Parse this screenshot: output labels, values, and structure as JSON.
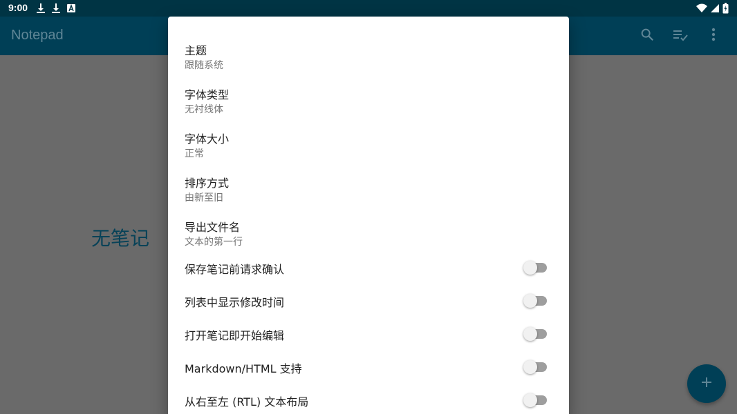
{
  "status_bar": {
    "time": "9:00",
    "left_icons": [
      "download-icon",
      "download-icon",
      "font-app-icon"
    ],
    "right_icons": [
      "wifi-icon",
      "cellular-signal-icon",
      "battery-icon"
    ]
  },
  "app_bar": {
    "title": "Notepad",
    "actions": [
      "search-icon",
      "select-all-icon",
      "more-vert-icon"
    ]
  },
  "main": {
    "empty_message": "无笔记"
  },
  "fab": {
    "icon": "add-icon"
  },
  "dialog": {
    "items": [
      {
        "title": "主题",
        "summary": "跟随系统"
      },
      {
        "title": "字体类型",
        "summary": "无衬线体"
      },
      {
        "title": "字体大小",
        "summary": "正常"
      },
      {
        "title": "排序方式",
        "summary": "由新至旧"
      },
      {
        "title": "导出文件名",
        "summary": "文本的第一行"
      }
    ],
    "switches": [
      {
        "title": "保存笔记前请求确认",
        "checked": false
      },
      {
        "title": "列表中显示修改时间",
        "checked": false
      },
      {
        "title": "打开笔记即开始编辑",
        "checked": false
      },
      {
        "title": "Markdown/HTML 支持",
        "checked": false
      },
      {
        "title": "从右至左 (RTL) 文本布局",
        "checked": false
      }
    ]
  },
  "colors": {
    "status_bar": "#003444",
    "app_bar": "#003f56",
    "scrim_background": "#6a6a6a",
    "accent": "#074258",
    "toggle_track_off": "#9e9e9e",
    "toggle_thumb_off": "#f1f1f1"
  }
}
